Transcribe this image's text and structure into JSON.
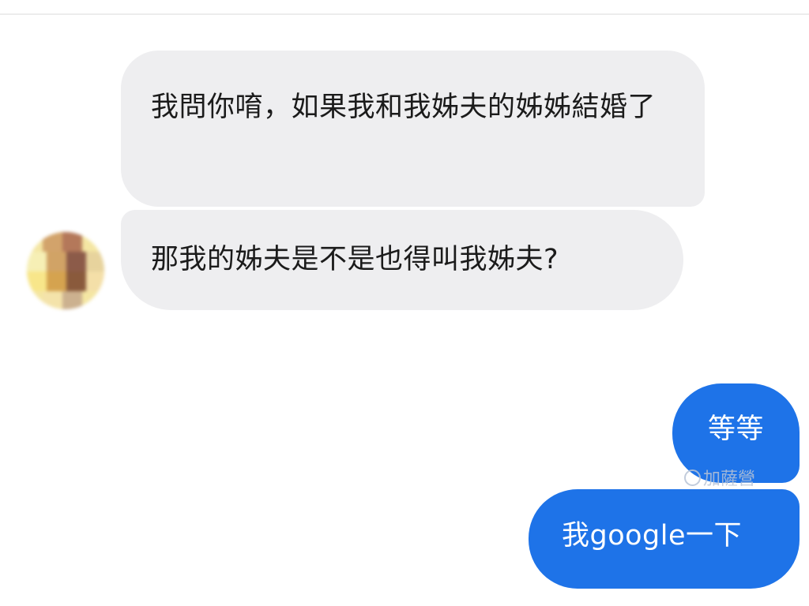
{
  "conversation": {
    "incoming": [
      {
        "text": "我問你唷，如果我和我姊夫的姊姊結婚了"
      },
      {
        "text": "那我的姊夫是不是也得叫我姊夫?"
      }
    ],
    "outgoing": [
      {
        "text": "等等"
      },
      {
        "text": "我google一下"
      }
    ]
  },
  "watermark": {
    "text": "加薩營"
  },
  "avatar": {
    "state": "pixelated"
  },
  "colors": {
    "incoming_bubble": "#eeeef0",
    "outgoing_bubble": "#1e73e8",
    "incoming_text": "#1b1b1b",
    "outgoing_text": "#ffffff"
  }
}
